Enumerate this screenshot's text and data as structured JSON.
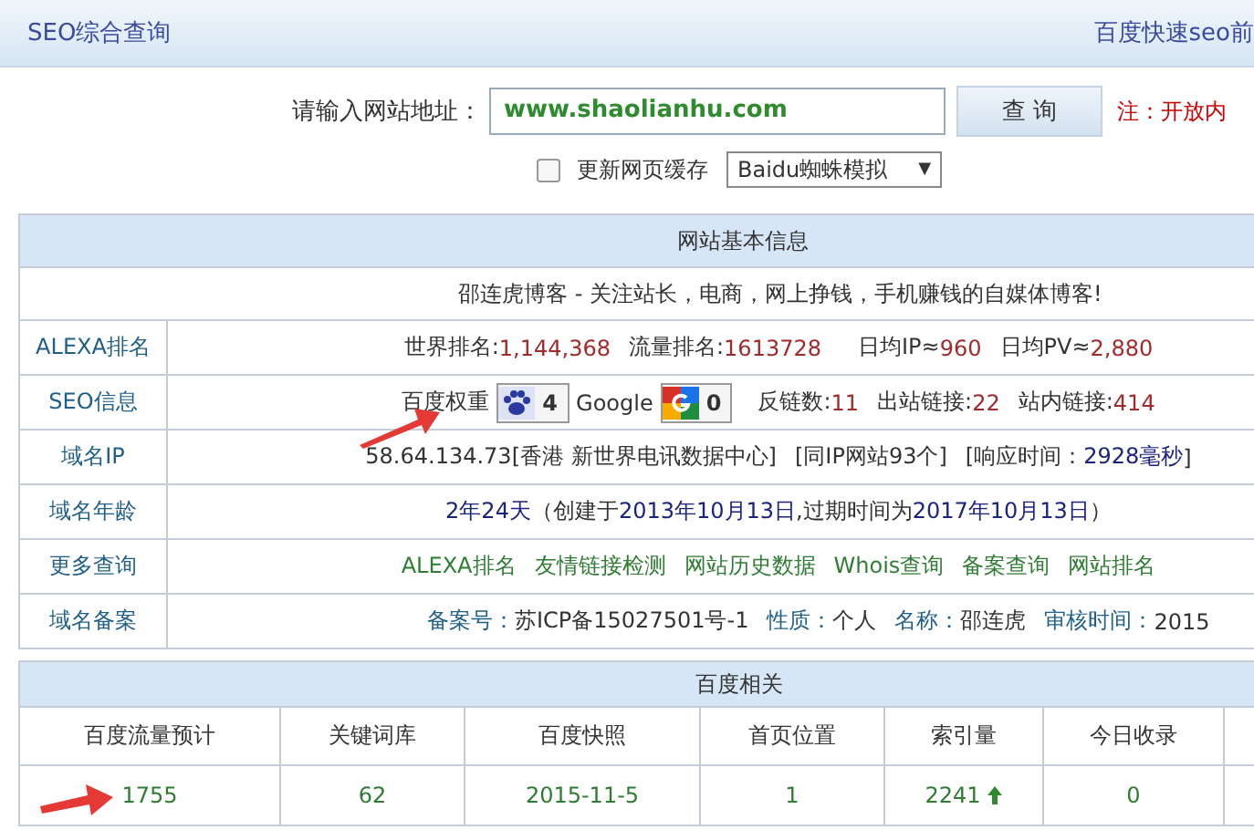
{
  "header": {
    "title": "SEO综合查询",
    "right_link": "百度快速seo前"
  },
  "query": {
    "label": "请输入网站地址：",
    "url_value": "www.shaolianhu.com",
    "button": "查 询",
    "note": "注：开放内",
    "cache": {
      "label": "更新网页缓存",
      "checked": false
    },
    "spider_select": "Baidu蜘蛛模拟",
    "dropdown_arrow": "▼"
  },
  "basic_info": {
    "title": "网站基本信息",
    "slogan": "邵连虎博客 - 关注站长，电商，网上挣钱，手机赚钱的自媒体博客!",
    "rows": [
      {
        "label": "ALEXA排名",
        "segments": [
          {
            "kind": "plain",
            "text": "世界排名:"
          },
          {
            "kind": "num",
            "text": "1,144,368"
          },
          {
            "kind": "gap"
          },
          {
            "kind": "plain",
            "text": "流量排名:"
          },
          {
            "kind": "num",
            "text": "1613728"
          },
          {
            "kind": "gap"
          },
          {
            "kind": "gap"
          },
          {
            "kind": "plain",
            "text": "日均IP≈"
          },
          {
            "kind": "num",
            "text": "960"
          },
          {
            "kind": "gap"
          },
          {
            "kind": "plain",
            "text": "日均PV≈"
          },
          {
            "kind": "num",
            "text": "2,880"
          }
        ]
      },
      {
        "label": "SEO信息",
        "segments": [
          {
            "kind": "plain",
            "text": "百度权重"
          },
          {
            "kind": "paw-badge",
            "text": "4"
          },
          {
            "kind": "plain",
            "text": "Google"
          },
          {
            "kind": "g-badge",
            "text": "0"
          },
          {
            "kind": "gap"
          },
          {
            "kind": "plain",
            "text": "反链数:"
          },
          {
            "kind": "num",
            "text": "11"
          },
          {
            "kind": "gap"
          },
          {
            "kind": "plain",
            "text": "出站链接:"
          },
          {
            "kind": "num",
            "text": "22"
          },
          {
            "kind": "gap"
          },
          {
            "kind": "plain",
            "text": "站内链接:"
          },
          {
            "kind": "num",
            "text": "414"
          }
        ]
      },
      {
        "label": "域名IP",
        "segments": [
          {
            "kind": "plain",
            "text": "58.64.134.73[香港 新世界电讯数据中心]"
          },
          {
            "kind": "gap"
          },
          {
            "kind": "plain",
            "text": "[同IP网站93个]"
          },
          {
            "kind": "gap"
          },
          {
            "kind": "plain",
            "text": "[响应时间："
          },
          {
            "kind": "navy",
            "text": "2928毫秒"
          },
          {
            "kind": "plain",
            "text": "]"
          }
        ]
      },
      {
        "label": "域名年龄",
        "segments": [
          {
            "kind": "navy",
            "text": "2年24天"
          },
          {
            "kind": "plain",
            "text": "（创建于"
          },
          {
            "kind": "navy",
            "text": "2013年10月13日"
          },
          {
            "kind": "plain",
            "text": ",过期时间为"
          },
          {
            "kind": "navy",
            "text": "2017年10月13日"
          },
          {
            "kind": "plain",
            "text": "）"
          }
        ]
      },
      {
        "label": "更多查询",
        "segments": [
          {
            "kind": "link",
            "text": "ALEXA排名"
          },
          {
            "kind": "gap"
          },
          {
            "kind": "link",
            "text": "友情链接检测"
          },
          {
            "kind": "gap"
          },
          {
            "kind": "link",
            "text": "网站历史数据"
          },
          {
            "kind": "gap"
          },
          {
            "kind": "link",
            "text": "Whois查询"
          },
          {
            "kind": "gap"
          },
          {
            "kind": "link",
            "text": "备案查询"
          },
          {
            "kind": "gap"
          },
          {
            "kind": "link",
            "text": "网站排名"
          }
        ]
      },
      {
        "label": "域名备案",
        "segments": [
          {
            "kind": "key",
            "text": "备案号："
          },
          {
            "kind": "plain",
            "text": "苏ICP备15027501号-1"
          },
          {
            "kind": "gap"
          },
          {
            "kind": "key",
            "text": "性质："
          },
          {
            "kind": "plain",
            "text": "个人"
          },
          {
            "kind": "gap"
          },
          {
            "kind": "key",
            "text": "名称："
          },
          {
            "kind": "plain",
            "text": "邵连虎"
          },
          {
            "kind": "gap"
          },
          {
            "kind": "key",
            "text": "审核时间："
          },
          {
            "kind": "plain",
            "text": "2015"
          }
        ]
      }
    ]
  },
  "baidu_info": {
    "title": "百度相关",
    "columns": [
      "百度流量预计",
      "关键词库",
      "百度快照",
      "首页位置",
      "索引量",
      "今日收录"
    ],
    "rows": [
      {
        "cells": [
          {
            "text": "1755"
          },
          {
            "text": "62"
          },
          {
            "text": "2015-11-5"
          },
          {
            "text": "1"
          },
          {
            "text": "2241",
            "rising": true
          },
          {
            "text": "0"
          }
        ]
      }
    ]
  }
}
